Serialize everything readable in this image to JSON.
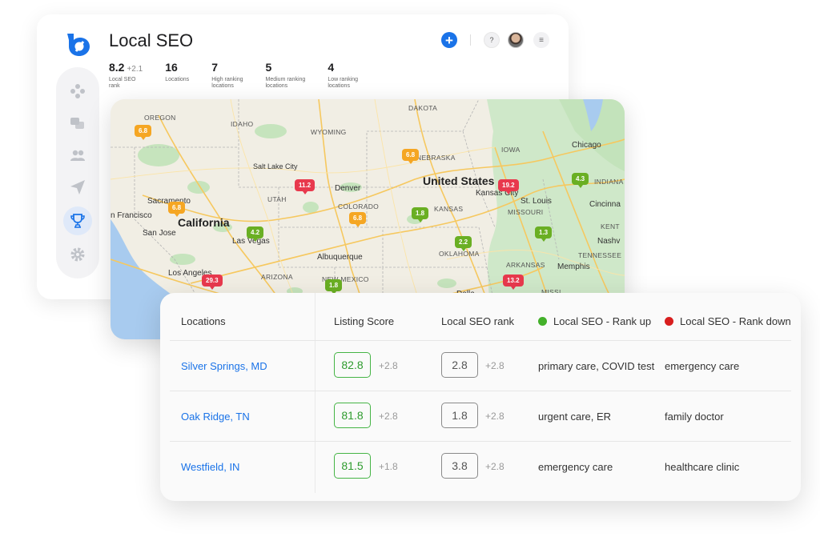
{
  "app": {
    "title": "Local SEO"
  },
  "stats": [
    {
      "value": "8.2",
      "delta": "+2.1",
      "label": "Local SEO\nrank"
    },
    {
      "value": "16",
      "delta": "",
      "label": "Locations"
    },
    {
      "value": "7",
      "delta": "",
      "label": "High ranking\nlocations"
    },
    {
      "value": "5",
      "delta": "",
      "label": "Medium ranking\nlocations"
    },
    {
      "value": "4",
      "delta": "",
      "label": "Low ranking\nlocations"
    }
  ],
  "sidebar": {
    "items": [
      {
        "icon": "hub-icon",
        "active": false
      },
      {
        "icon": "chat-icon",
        "active": false
      },
      {
        "icon": "users-icon",
        "active": false
      },
      {
        "icon": "send-icon",
        "active": false
      },
      {
        "icon": "trophy-icon",
        "active": true
      },
      {
        "icon": "gear-icon",
        "active": false
      }
    ]
  },
  "map": {
    "labels": {
      "oregon": "OREGON",
      "idaho": "IDAHO",
      "wyoming": "WYOMING",
      "dakota": "DAKOTA",
      "nebraska": "NEBRASKA",
      "iowa": "IOWA",
      "chicago": "Chicago",
      "indiana": "INDIANA",
      "salt_lake": "Salt Lake City",
      "utah": "UTAH",
      "denver": "Denver",
      "colorado": "COLORADO",
      "united_states": "United States",
      "kansas_city": "Kansas City",
      "kansas": "KANSAS",
      "missouri": "MISSOURI",
      "st_louis": "St. Louis",
      "cincinnati": "Cincinna",
      "sacramento": "Sacramento",
      "san_francisco": "n Francisco",
      "california": "California",
      "san_jose": "San Jose",
      "las_vegas": "Las Vegas",
      "albuquerque": "Albuquerque",
      "oklahoma": "OKLAHOMA",
      "arkansas": "ARKANSAS",
      "memphis": "Memphis",
      "tennessee": "TENNESSEE",
      "nashville": "Nashv",
      "kentucky": "KENT",
      "los_angeles": "Los Angeles",
      "arizona": "ARIZONA",
      "new_mexico": "NEW MEXICO",
      "mississippi": "MISSI",
      "dallas": "Dalla"
    },
    "pins": [
      {
        "value": "6.8",
        "level": "medium"
      },
      {
        "value": "6.8",
        "level": "medium"
      },
      {
        "value": "11.2",
        "level": "low"
      },
      {
        "value": "19.2",
        "level": "low"
      },
      {
        "value": "4.3",
        "level": "high"
      },
      {
        "value": "6.8",
        "level": "medium"
      },
      {
        "value": "6.8",
        "level": "medium"
      },
      {
        "value": "1.8",
        "level": "high"
      },
      {
        "value": "4.2",
        "level": "high"
      },
      {
        "value": "1.3",
        "level": "high"
      },
      {
        "value": "2.2",
        "level": "high"
      },
      {
        "value": "29.3",
        "level": "low"
      },
      {
        "value": "13.2",
        "level": "low"
      },
      {
        "value": "1.8",
        "level": "high"
      }
    ]
  },
  "colors": {
    "high": "#6aaf23",
    "medium": "#f5a623",
    "low": "#e8394d",
    "up_dot": "#43b02a",
    "down_dot": "#d81e1e"
  },
  "table": {
    "headers": {
      "locations": "Locations",
      "listing_score": "Listing Score",
      "local_seo_rank": "Local SEO rank",
      "rank_up": "Local SEO - Rank up",
      "rank_down": "Local SEO - Rank down"
    },
    "rows": [
      {
        "location": "Silver Springs, MD",
        "score": "82.8",
        "score_delta": "+2.8",
        "rank": "2.8",
        "rank_delta": "+2.8",
        "rank_up": "primary care, COVID test",
        "rank_down": "emergency care"
      },
      {
        "location": "Oak Ridge, TN",
        "score": "81.8",
        "score_delta": "+2.8",
        "rank": "1.8",
        "rank_delta": "+2.8",
        "rank_up": "urgent care, ER",
        "rank_down": "family doctor"
      },
      {
        "location": "Westfield, IN",
        "score": "81.5",
        "score_delta": "+1.8",
        "rank": "3.8",
        "rank_delta": "+2.8",
        "rank_up": "emergency care",
        "rank_down": "healthcare clinic"
      }
    ]
  }
}
